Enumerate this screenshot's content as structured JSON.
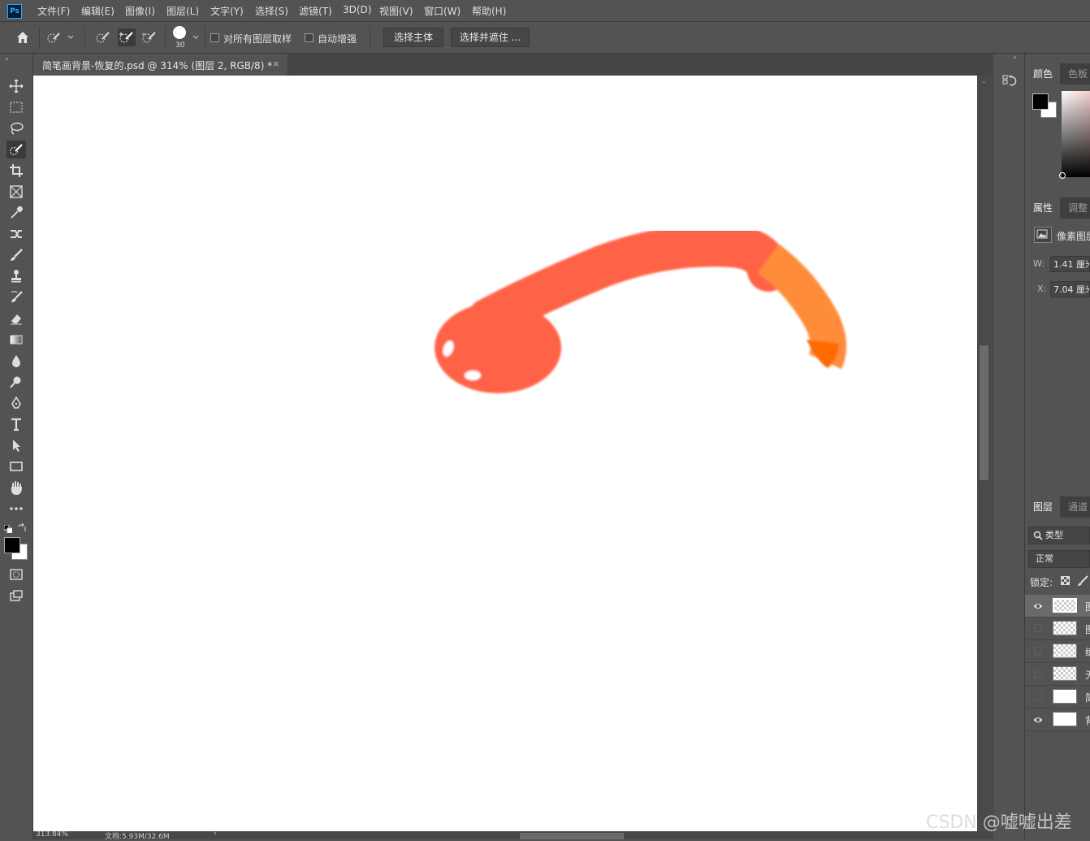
{
  "app": {
    "logo_text": "Ps"
  },
  "menu": [
    "文件(F)",
    "编辑(E)",
    "图像(I)",
    "图层(L)",
    "文字(Y)",
    "选择(S)",
    "滤镜(T)",
    "3D(D)",
    "视图(V)",
    "窗口(W)",
    "帮助(H)"
  ],
  "options": {
    "brush_size": "30",
    "sample_all_layers": "对所有图层取样",
    "auto_enhance": "自动增强",
    "select_subject": "选择主体",
    "select_and_mask": "选择并遮住 ..."
  },
  "document": {
    "title": "简笔画背景-恢复的.psd @ 314% (图层 2, RGB/8) *",
    "close": "×"
  },
  "status": {
    "zoom": "313.84%",
    "doc_size": "文档:5.93M/32.6M",
    "arrow": "›"
  },
  "panels": {
    "color_tabs": [
      "颜色",
      "色板"
    ],
    "properties_tabs": [
      "属性",
      "调整"
    ],
    "properties_type": "像素图层",
    "w_label": "W:",
    "w_value": "1.41 厘米",
    "x_label": "X:",
    "x_value": "7.04 厘米",
    "layers_tabs": [
      "图层",
      "通道"
    ],
    "filter_kind": "类型",
    "blend_mode": "正常",
    "lock_label": "锁定:"
  },
  "layers": [
    {
      "name": "图",
      "visible": true,
      "selected": true,
      "thumb": "transparent"
    },
    {
      "name": "图",
      "visible": false,
      "selected": false,
      "thumb": "transparent"
    },
    {
      "name": "练",
      "visible": false,
      "selected": false,
      "thumb": "transparent"
    },
    {
      "name": "无",
      "visible": false,
      "selected": false,
      "thumb": "transparent"
    },
    {
      "name": "简",
      "visible": false,
      "selected": false,
      "thumb": "white"
    },
    {
      "name": "背",
      "visible": true,
      "selected": false,
      "thumb": "white"
    }
  ],
  "colors": {
    "snake_body": "#ff6347",
    "snake_tail": "#ff8c3a",
    "foreground": "#000000",
    "background": "#ffffff"
  },
  "watermark": "CSDN @嘘嘘出差"
}
